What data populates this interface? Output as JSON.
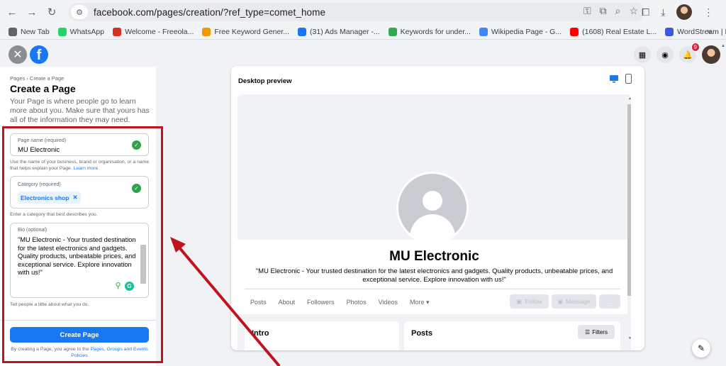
{
  "browser": {
    "url": "facebook.com/pages/creation/?ref_type=comet_home",
    "bookmarks": [
      {
        "label": "New Tab",
        "color": "#5f6368"
      },
      {
        "label": "WhatsApp",
        "color": "#25d366"
      },
      {
        "label": "Welcome - Freeola...",
        "color": "#d93025"
      },
      {
        "label": "Free Keyword Gener...",
        "color": "#f29900"
      },
      {
        "label": "(31) Ads Manager -...",
        "color": "#1877f2"
      },
      {
        "label": "Keywords for under...",
        "color": "#34a853"
      },
      {
        "label": "Wikipedia Page - G...",
        "color": "#4285f4"
      },
      {
        "label": "(1608) Real Estate L...",
        "color": "#ff0000"
      },
      {
        "label": "WordStream | Free...",
        "color": "#3b5bdb"
      }
    ],
    "more": "»"
  },
  "header": {
    "notification_count": "9"
  },
  "left_panel": {
    "breadcrumb": "Pages › Create a Page",
    "title": "Create a Page",
    "description": "Your Page is where people go to learn more about you. Make sure that yours has all of the information they may need.",
    "page_name": {
      "label": "Page name (required)",
      "value": "MU Electronic",
      "help": "Use the name of your business, brand or organisation, or a name that helps explain your Page.",
      "help_link": "Learn more"
    },
    "category": {
      "label": "Category (required)",
      "chip": "Electronics shop",
      "help": "Enter a category that best describes you."
    },
    "bio": {
      "label": "Bio (optional)",
      "value": "\"MU Electronic - Your trusted destination for the latest electronics and gadgets. Quality products, unbeatable prices, and exceptional service. Explore innovation with us!\"",
      "help": "Tell people a little about what you do."
    },
    "create_button": "Create Page",
    "terms_prefix": "By creating a Page, you agree to the",
    "terms_link": "Pages, Groups and Events Policies"
  },
  "preview": {
    "title": "Desktop preview",
    "page_name": "MU Electronic",
    "bio": "\"MU Electronic - Your trusted destination for the latest electronics and gadgets. Quality products, unbeatable prices, and exceptional service. Explore innovation with us!\"",
    "tabs": [
      "Posts",
      "About",
      "Followers",
      "Photos",
      "Videos",
      "More ▾"
    ],
    "follow": "Follow",
    "message": "Message",
    "more_actions": "···",
    "intro": "Intro",
    "posts": "Posts",
    "filters": "Filters"
  },
  "colors": {
    "brand": "#1877f2",
    "annotation": "#c1121f",
    "success": "#31a24c"
  }
}
